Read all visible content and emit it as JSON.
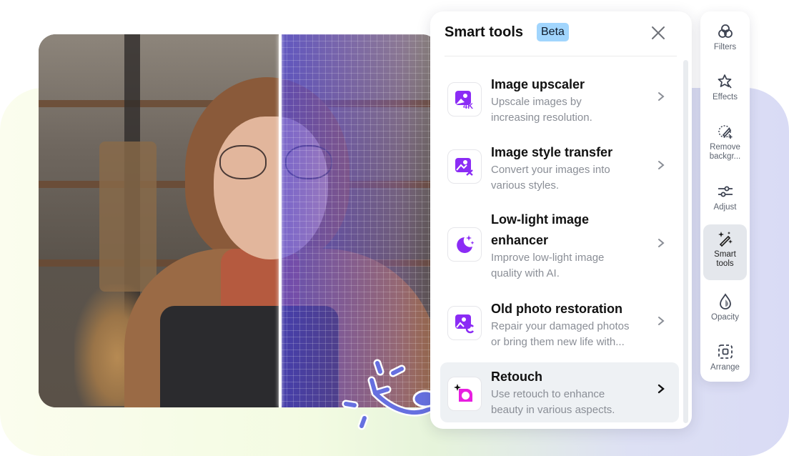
{
  "panel": {
    "title": "Smart tools",
    "badge": "Beta",
    "close_icon": "close-icon",
    "items": [
      {
        "title": "Image upscaler",
        "desc_line1": "Upscale images by",
        "desc_line2": "increasing resolution.",
        "icon": "image-4k-icon"
      },
      {
        "title": "Image style transfer",
        "desc_line1": "Convert your images into",
        "desc_line2": "various styles.",
        "icon": "image-style-icon"
      },
      {
        "title_line1": "Low-light image",
        "title_line2": "enhancer",
        "desc_line1": "Improve low-light image",
        "desc_line2": "quality with AI.",
        "icon": "moon-stars-icon"
      },
      {
        "title": "Old photo restoration",
        "desc_line1": "Repair your damaged photos",
        "desc_line2": "or bring them new life with...",
        "icon": "photo-restore-icon"
      },
      {
        "title": "Retouch",
        "desc_line1": "Use retouch to enhance",
        "desc_line2": "beauty in various aspects.",
        "icon": "retouch-icon",
        "active": true
      }
    ]
  },
  "toolbar": {
    "items": [
      {
        "label": "Filters",
        "icon": "filters-icon"
      },
      {
        "label": "Effects",
        "icon": "effects-icon"
      },
      {
        "label_line1": "Remove",
        "label_line2": "backgr...",
        "icon": "remove-background-icon"
      },
      {
        "label": "Adjust",
        "icon": "adjust-icon"
      },
      {
        "label_line1": "Smart",
        "label_line2": "tools",
        "icon": "magic-wand-icon",
        "active": true
      },
      {
        "label": "Opacity",
        "icon": "opacity-icon"
      },
      {
        "label": "Arrange",
        "icon": "arrange-icon"
      }
    ]
  },
  "colors": {
    "accent_purple": "#8b2cf5",
    "retouch_pink": "#e81ee0",
    "doodle_blue": "#6670e0",
    "beta_bg": "#a1d5fd"
  }
}
